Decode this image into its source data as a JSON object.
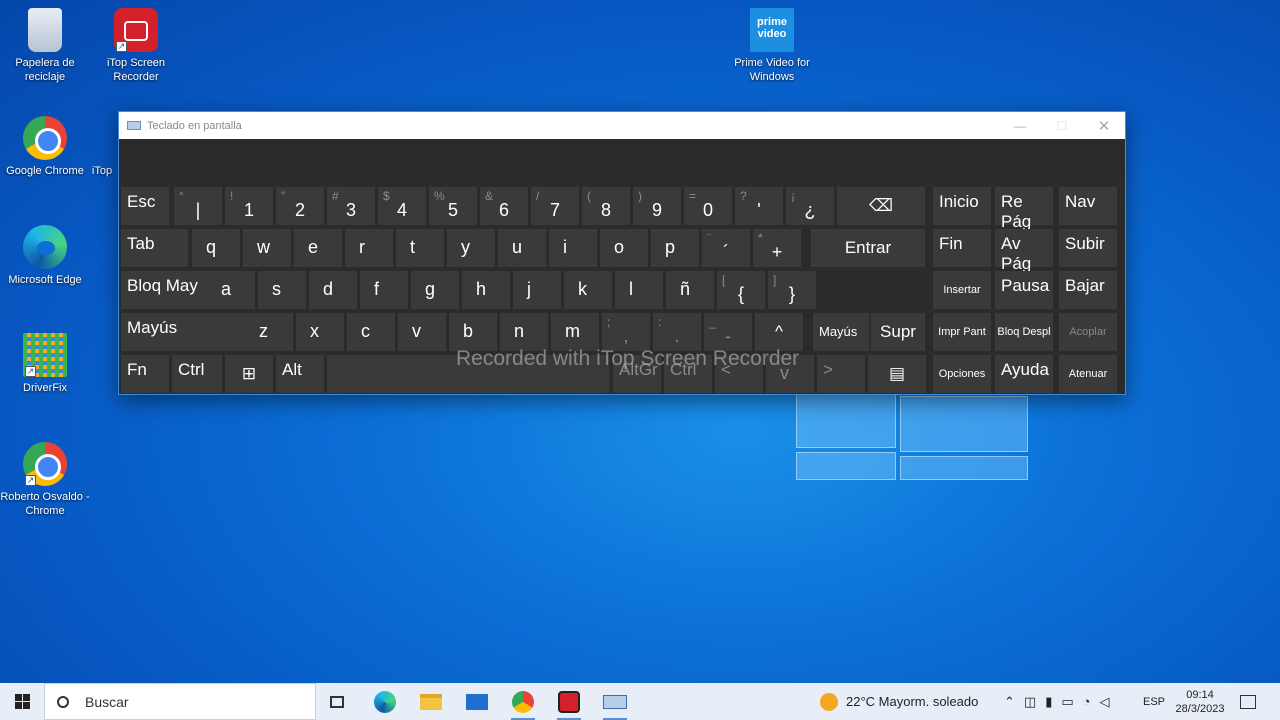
{
  "desktop": {
    "icons": [
      {
        "label": "Papelera de reciclaje",
        "icon": "recycle-bin-icon"
      },
      {
        "label": "iTop Screen Recorder",
        "icon": "itop-recorder-icon"
      },
      {
        "label": "Google Chrome",
        "icon": "chrome-icon"
      },
      {
        "label": "iTop",
        "icon": "itop-icon"
      },
      {
        "label": "Microsoft Edge",
        "icon": "edge-icon"
      },
      {
        "label": "DriverFix",
        "icon": "driverfix-icon"
      },
      {
        "label": "Roberto Osvaldo - Chrome",
        "icon": "chrome-profile-icon"
      },
      {
        "label": "Prime Video for Windows",
        "icon": "prime-video-icon",
        "logo_text": "prime video"
      }
    ]
  },
  "osk": {
    "title": "Teclado en pantalla",
    "watermark": "Recorded with iTop Screen Recorder",
    "row1": [
      {
        "main": "Esc"
      },
      {
        "shift": "°",
        "main": "|"
      },
      {
        "shift": "!",
        "main": "1"
      },
      {
        "shift": "\"",
        "main": "2"
      },
      {
        "shift": "#",
        "main": "3"
      },
      {
        "shift": "$",
        "main": "4"
      },
      {
        "shift": "%",
        "main": "5"
      },
      {
        "shift": "&",
        "main": "6"
      },
      {
        "shift": "/",
        "main": "7"
      },
      {
        "shift": "(",
        "main": "8"
      },
      {
        "shift": ")",
        "main": "9"
      },
      {
        "shift": "=",
        "main": "0"
      },
      {
        "shift": "?",
        "main": "'"
      },
      {
        "shift": "¡",
        "main": "¿"
      },
      {
        "main": "⌫"
      }
    ],
    "row2": [
      {
        "main": "Tab"
      },
      {
        "main": "q"
      },
      {
        "main": "w"
      },
      {
        "main": "e"
      },
      {
        "main": "r"
      },
      {
        "main": "t"
      },
      {
        "main": "y"
      },
      {
        "main": "u"
      },
      {
        "main": "i"
      },
      {
        "main": "o"
      },
      {
        "main": "p"
      },
      {
        "shift": "¨",
        "main": "´"
      },
      {
        "shift": "*",
        "main": "+"
      },
      {
        "main": "Entrar"
      }
    ],
    "row3": [
      {
        "main": "Bloq May"
      },
      {
        "main": "a"
      },
      {
        "main": "s"
      },
      {
        "main": "d"
      },
      {
        "main": "f"
      },
      {
        "main": "g"
      },
      {
        "main": "h"
      },
      {
        "main": "j"
      },
      {
        "main": "k"
      },
      {
        "main": "l"
      },
      {
        "main": "ñ"
      },
      {
        "shift": "[",
        "main": "{"
      },
      {
        "shift": "]",
        "main": "}"
      }
    ],
    "row4": [
      {
        "main": "Mayús"
      },
      {
        "main": "z"
      },
      {
        "main": "x"
      },
      {
        "main": "c"
      },
      {
        "main": "v"
      },
      {
        "main": "b"
      },
      {
        "main": "n"
      },
      {
        "main": "m"
      },
      {
        "shift": ";",
        "main": ","
      },
      {
        "shift": ":",
        "main": "."
      },
      {
        "shift": "_",
        "main": "-"
      },
      {
        "main": "^"
      },
      {
        "main": "Mayús"
      },
      {
        "main": "Supr"
      }
    ],
    "row5": [
      {
        "main": "Fn"
      },
      {
        "main": "Ctrl"
      },
      {
        "main": "⊞"
      },
      {
        "main": "Alt"
      },
      {
        "main": ""
      },
      {
        "main": "AltGr"
      },
      {
        "main": "Ctrl"
      },
      {
        "main": "<"
      },
      {
        "main": "v"
      },
      {
        "main": ">"
      },
      {
        "main": "▤"
      }
    ],
    "nav": [
      [
        "Inicio",
        "Re Pág",
        "Nav"
      ],
      [
        "Fin",
        "Av Pág",
        "Subir"
      ],
      [
        "Insertar",
        "Pausa",
        "Bajar"
      ],
      [
        "Impr Pant",
        "Bloq Despl",
        "Acoplar"
      ],
      [
        "Opciones",
        "Ayuda",
        "Atenuar"
      ]
    ]
  },
  "taskbar": {
    "search_placeholder": "Buscar",
    "weather": "22°C  Mayorm. soleado",
    "language": "ESP",
    "time": "09:14",
    "date": "28/3/2023"
  }
}
